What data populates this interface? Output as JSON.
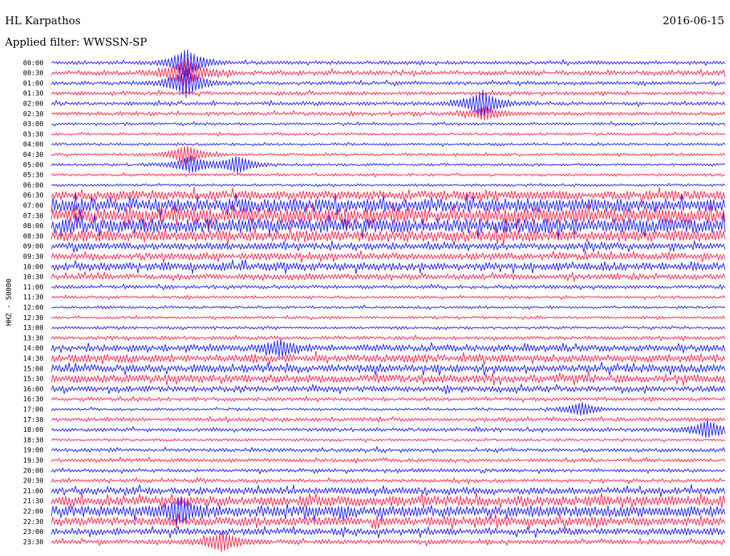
{
  "header": {
    "station": "HL Karpathos",
    "date": "2016-06-15",
    "filter": "Applied filter: WWSSN-SP",
    "channel": "HHZ - 50000"
  },
  "chart_data": {
    "type": "line",
    "title": "HL Karpathos",
    "subtitle": "Applied filter: WWSSN-SP",
    "ylabel": "HHZ - 50000",
    "colors": [
      "#1a1aff",
      "#ff1f4b"
    ],
    "rows": [
      "00:00",
      "00:30",
      "01:00",
      "01:30",
      "02:00",
      "02:30",
      "03:00",
      "03:30",
      "04:00",
      "04:30",
      "05:00",
      "05:30",
      "06:00",
      "06:30",
      "07:00",
      "07:30",
      "08:00",
      "08:30",
      "09:00",
      "09:30",
      "10:00",
      "10:30",
      "11:00",
      "11:30",
      "12:00",
      "12:30",
      "13:00",
      "13:30",
      "14:00",
      "14:30",
      "15:00",
      "15:30",
      "16:00",
      "16:30",
      "17:00",
      "17:30",
      "18:00",
      "18:30",
      "19:00",
      "19:30",
      "20:00",
      "20:30",
      "21:00",
      "21:30",
      "22:00",
      "22:30",
      "23:00",
      "23:30"
    ],
    "noise_level": [
      3,
      4,
      3,
      3,
      3,
      3,
      2,
      2,
      2,
      2,
      2,
      2,
      2,
      8,
      12,
      13,
      13,
      10,
      6,
      6,
      7,
      5,
      3,
      2,
      2,
      2,
      2,
      3,
      6,
      7,
      7,
      7,
      5,
      3,
      2,
      3,
      3,
      2,
      3,
      3,
      3,
      3,
      6,
      9,
      10,
      8,
      6,
      4
    ],
    "events": [
      {
        "row": 0,
        "minute": 6.0,
        "amplitude": 30
      },
      {
        "row": 1,
        "minute": 6.0,
        "amplitude": 30
      },
      {
        "row": 2,
        "minute": 6.0,
        "amplitude": 30
      },
      {
        "row": 9,
        "minute": 6.0,
        "amplitude": 20
      },
      {
        "row": 10,
        "minute": 6.2,
        "amplitude": 18
      },
      {
        "row": 4,
        "minute": 19.2,
        "amplitude": 28
      },
      {
        "row": 5,
        "minute": 19.3,
        "amplitude": 14
      },
      {
        "row": 10,
        "minute": 8.3,
        "amplitude": 18
      },
      {
        "row": 44,
        "minute": 5.8,
        "amplitude": 22
      },
      {
        "row": 47,
        "minute": 7.6,
        "amplitude": 20
      },
      {
        "row": 36,
        "minute": 29.2,
        "amplitude": 18
      },
      {
        "row": 34,
        "minute": 23.6,
        "amplitude": 14
      },
      {
        "row": 28,
        "minute": 10.2,
        "amplitude": 15
      }
    ]
  }
}
